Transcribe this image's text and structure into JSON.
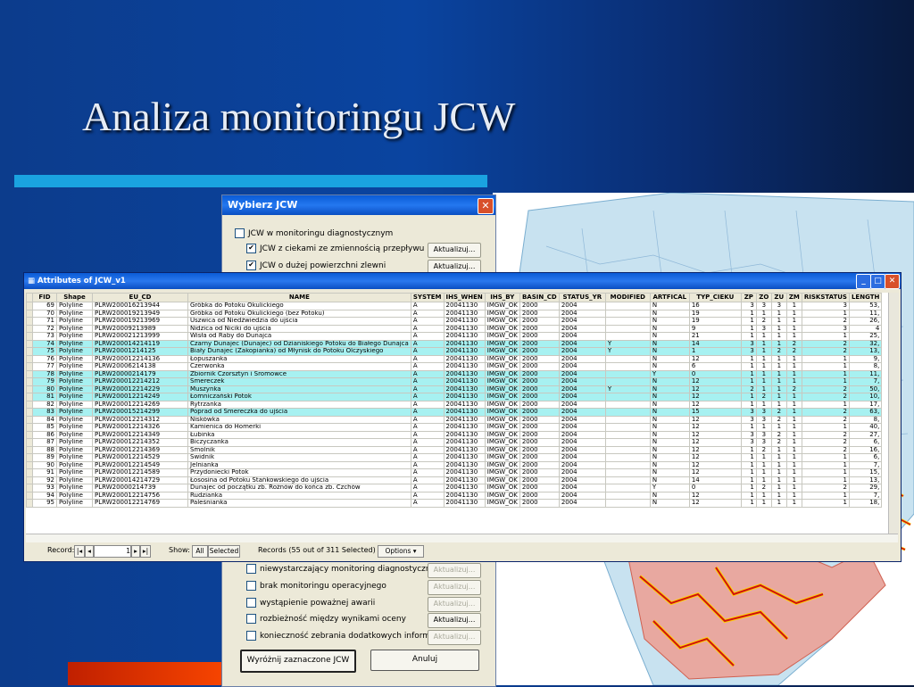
{
  "slide": {
    "title": "Analiza monitoringu JCW"
  },
  "dialog": {
    "title": "Wybierz JCW",
    "options_top": [
      {
        "label": "JCW w monitoringu diagnostycznym",
        "checked": false
      },
      {
        "label": "JCW z ciekami ze zmiennością przepływu",
        "checked": true,
        "button": "Aktualizuj...",
        "enabled": true
      },
      {
        "label": "JCW o dużej powierzchni zlewni",
        "checked": true,
        "button": "Aktualizuj...",
        "enabled": true
      }
    ],
    "options_bottom": [
      {
        "label": "niewystarczający monitoring diagnostyczny",
        "checked": false,
        "button": "Aktualizuj...",
        "enabled": false
      },
      {
        "label": "brak monitoringu operacyjnego",
        "checked": false,
        "button": "Aktualizuj...",
        "enabled": false
      },
      {
        "label": "wystąpienie poważnej awarii",
        "checked": false,
        "button": "Aktualizuj...",
        "enabled": false
      },
      {
        "label": "rozbieżność między wynikami oceny",
        "checked": false,
        "button": "Aktualizuj...",
        "enabled": true
      },
      {
        "label": "konieczność zebrania dodatkowych informacji",
        "checked": false,
        "button": "Aktualizuj...",
        "enabled": false
      }
    ],
    "highlight_button": "Wyróżnij zaznaczone JCW",
    "cancel_button": "Anuluj"
  },
  "attributes": {
    "title": "Attributes of JCW_v1",
    "columns": [
      "FID",
      "Shape",
      "EU_CD",
      "NAME",
      "SYSTEM",
      "IHS_WHEN",
      "IHS_BY",
      "BASIN_CD",
      "STATUS_YR",
      "MODIFIED",
      "ARTFICAL",
      "TYP_CIEKU",
      "ZP",
      "ZO",
      "ZU",
      "ZM",
      "RISKSTATUS",
      "LENGTH"
    ],
    "rows": [
      [
        "69",
        "Polyline",
        "PLRW200016213944",
        "Grôbka do Potoku Okulickiego",
        "A",
        "20041130",
        "IMGW_OK",
        "2000",
        "2004",
        "",
        "N",
        "16",
        "3",
        "3",
        "3",
        "1",
        "3",
        "53,",
        false
      ],
      [
        "70",
        "Polyline",
        "PLRW200019213949",
        "Grôbka od Potoku Okulickiego (bez Potoku)",
        "A",
        "20041130",
        "IMGW_OK",
        "2000",
        "2004",
        "",
        "N",
        "19",
        "1",
        "1",
        "1",
        "1",
        "1",
        "11,",
        false
      ],
      [
        "71",
        "Polyline",
        "PLRW200019213969",
        "Uszwica od Niedźwiedzia do ujścia",
        "A",
        "20041130",
        "IMGW_OK",
        "2000",
        "2004",
        "",
        "N",
        "19",
        "1",
        "2",
        "1",
        "1",
        "2",
        "26,",
        false
      ],
      [
        "72",
        "Polyline",
        "PLRW20009213989",
        "Nidzica od Niciki do ujścia",
        "A",
        "20041130",
        "IMGW_OK",
        "2000",
        "2004",
        "",
        "N",
        "9",
        "1",
        "3",
        "1",
        "1",
        "3",
        "4",
        false
      ],
      [
        "73",
        "Polyline",
        "PLRW200021213999",
        "Wisła od Raby do Dunajca",
        "A",
        "20041130",
        "IMGW_OK",
        "2000",
        "2004",
        "",
        "N",
        "21",
        "1",
        "1",
        "1",
        "1",
        "1",
        "25,",
        false
      ],
      [
        "74",
        "Polyline",
        "PLRW200014214119",
        "Czarny Dunajec (Dunajec) od Dzianiskiego Potoku do Białego Dunajca",
        "A",
        "20041130",
        "IMGW_OK",
        "2000",
        "2004",
        "Y",
        "N",
        "14",
        "3",
        "1",
        "1",
        "2",
        "2",
        "32,",
        true
      ],
      [
        "75",
        "Polyline",
        "PLRW20001214125",
        "Biały Dunajec (Zakopianka) od Młynisk do Potoku Olczyskiego",
        "A",
        "20041130",
        "IMGW_OK",
        "2000",
        "2004",
        "Y",
        "N",
        "1",
        "3",
        "1",
        "2",
        "2",
        "2",
        "13,",
        true
      ],
      [
        "76",
        "Polyline",
        "PLRW200012214136",
        "Łopuszanka",
        "A",
        "20041130",
        "IMGW_OK",
        "2000",
        "2004",
        "",
        "N",
        "12",
        "1",
        "1",
        "1",
        "1",
        "1",
        "9,",
        false
      ],
      [
        "77",
        "Polyline",
        "PLRW20006214138",
        "Czerwonka",
        "A",
        "20041130",
        "IMGW_OK",
        "2000",
        "2004",
        "",
        "N",
        "6",
        "1",
        "1",
        "1",
        "1",
        "1",
        "8,",
        false
      ],
      [
        "78",
        "Polyline",
        "PLRW20000214179",
        "Zbiornik Czorsztyn i Sromowce",
        "A",
        "20041130",
        "IMGW_OK",
        "2000",
        "2004",
        "",
        "Y",
        "0",
        "1",
        "1",
        "1",
        "1",
        "1",
        "11,",
        true
      ],
      [
        "79",
        "Polyline",
        "PLRW200012214212",
        "Smereczek",
        "A",
        "20041130",
        "IMGW_OK",
        "2000",
        "2004",
        "",
        "N",
        "12",
        "1",
        "1",
        "1",
        "1",
        "1",
        "7,",
        true
      ],
      [
        "80",
        "Polyline",
        "PLRW200012214229",
        "Muszynka",
        "A",
        "20041130",
        "IMGW_OK",
        "2000",
        "2004",
        "Y",
        "N",
        "12",
        "2",
        "1",
        "1",
        "2",
        "2",
        "50,",
        true
      ],
      [
        "81",
        "Polyline",
        "PLRW200012214249",
        "Łomniczański Potok",
        "A",
        "20041130",
        "IMGW_OK",
        "2000",
        "2004",
        "",
        "N",
        "12",
        "1",
        "2",
        "1",
        "1",
        "2",
        "10,",
        true
      ],
      [
        "82",
        "Polyline",
        "PLRW200012214269",
        "Rytrzanka",
        "A",
        "20041130",
        "IMGW_OK",
        "2000",
        "2004",
        "",
        "N",
        "12",
        "1",
        "1",
        "1",
        "1",
        "1",
        "17,",
        false
      ],
      [
        "83",
        "Polyline",
        "PLRW200015214299",
        "Poprad od Smereczka do ujścia",
        "A",
        "20041130",
        "IMGW_OK",
        "2000",
        "2004",
        "",
        "N",
        "15",
        "3",
        "3",
        "2",
        "1",
        "2",
        "63,",
        true
      ],
      [
        "84",
        "Polyline",
        "PLRW200012214312",
        "Niskówka",
        "A",
        "20041130",
        "IMGW_OK",
        "2000",
        "2004",
        "",
        "N",
        "12",
        "3",
        "3",
        "2",
        "1",
        "2",
        "8,",
        false
      ],
      [
        "85",
        "Polyline",
        "PLRW200012214326",
        "Kamienica do Homerki",
        "A",
        "20041130",
        "IMGW_OK",
        "2000",
        "2004",
        "",
        "N",
        "12",
        "1",
        "1",
        "1",
        "1",
        "1",
        "40,",
        false
      ],
      [
        "86",
        "Polyline",
        "PLRW200012214349",
        "Łubinka",
        "A",
        "20041130",
        "IMGW_OK",
        "2000",
        "2004",
        "",
        "N",
        "12",
        "3",
        "3",
        "2",
        "1",
        "2",
        "27,",
        false
      ],
      [
        "87",
        "Polyline",
        "PLRW200012214352",
        "Biczyczanka",
        "A",
        "20041130",
        "IMGW_OK",
        "2000",
        "2004",
        "",
        "N",
        "12",
        "3",
        "3",
        "2",
        "1",
        "2",
        "6,",
        false
      ],
      [
        "88",
        "Polyline",
        "PLRW200012214369",
        "Smolnik",
        "A",
        "20041130",
        "IMGW_OK",
        "2000",
        "2004",
        "",
        "N",
        "12",
        "1",
        "2",
        "1",
        "1",
        "2",
        "16,",
        false
      ],
      [
        "89",
        "Polyline",
        "PLRW200012214529",
        "Świdnik",
        "A",
        "20041130",
        "IMGW_OK",
        "2000",
        "2004",
        "",
        "N",
        "12",
        "1",
        "1",
        "1",
        "1",
        "1",
        "6,",
        false
      ],
      [
        "90",
        "Polyline",
        "PLRW200012214549",
        "Jelnianka",
        "A",
        "20041130",
        "IMGW_OK",
        "2000",
        "2004",
        "",
        "N",
        "12",
        "1",
        "1",
        "1",
        "1",
        "1",
        "7,",
        false
      ],
      [
        "91",
        "Polyline",
        "PLRW200012214589",
        "Przydoniecki Potok",
        "A",
        "20041130",
        "IMGW_OK",
        "2000",
        "2004",
        "",
        "N",
        "12",
        "1",
        "1",
        "1",
        "1",
        "1",
        "15,",
        false
      ],
      [
        "92",
        "Polyline",
        "PLRW200014214729",
        "Łososina od Potoku Stańkowskiego do ujścia",
        "A",
        "20041130",
        "IMGW_OK",
        "2000",
        "2004",
        "",
        "N",
        "14",
        "1",
        "1",
        "1",
        "1",
        "1",
        "13,",
        false
      ],
      [
        "93",
        "Polyline",
        "PLRW20000214739",
        "Dunajec od początku zb. Rożnów do końca zb. Czchów",
        "A",
        "20041130",
        "IMGW_OK",
        "2000",
        "2004",
        "",
        "Y",
        "0",
        "1",
        "2",
        "1",
        "1",
        "2",
        "29,",
        false
      ],
      [
        "94",
        "Polyline",
        "PLRW200012214756",
        "Rudzianka",
        "A",
        "20041130",
        "IMGW_OK",
        "2000",
        "2004",
        "",
        "N",
        "12",
        "1",
        "1",
        "1",
        "1",
        "1",
        "7,",
        false
      ],
      [
        "95",
        "Polyline",
        "PLRW200012214769",
        "Paleśnianka",
        "A",
        "20041130",
        "IMGW_OK",
        "2000",
        "2004",
        "",
        "N",
        "12",
        "1",
        "1",
        "1",
        "1",
        "1",
        "18,",
        false
      ]
    ],
    "footer": {
      "record_label": "Record:",
      "record_value": "1",
      "show_label": "Show:",
      "all_btn": "All",
      "selected_btn": "Selected",
      "records_text": "Records (55 out of 311 Selected)",
      "options_btn": "Options"
    }
  }
}
